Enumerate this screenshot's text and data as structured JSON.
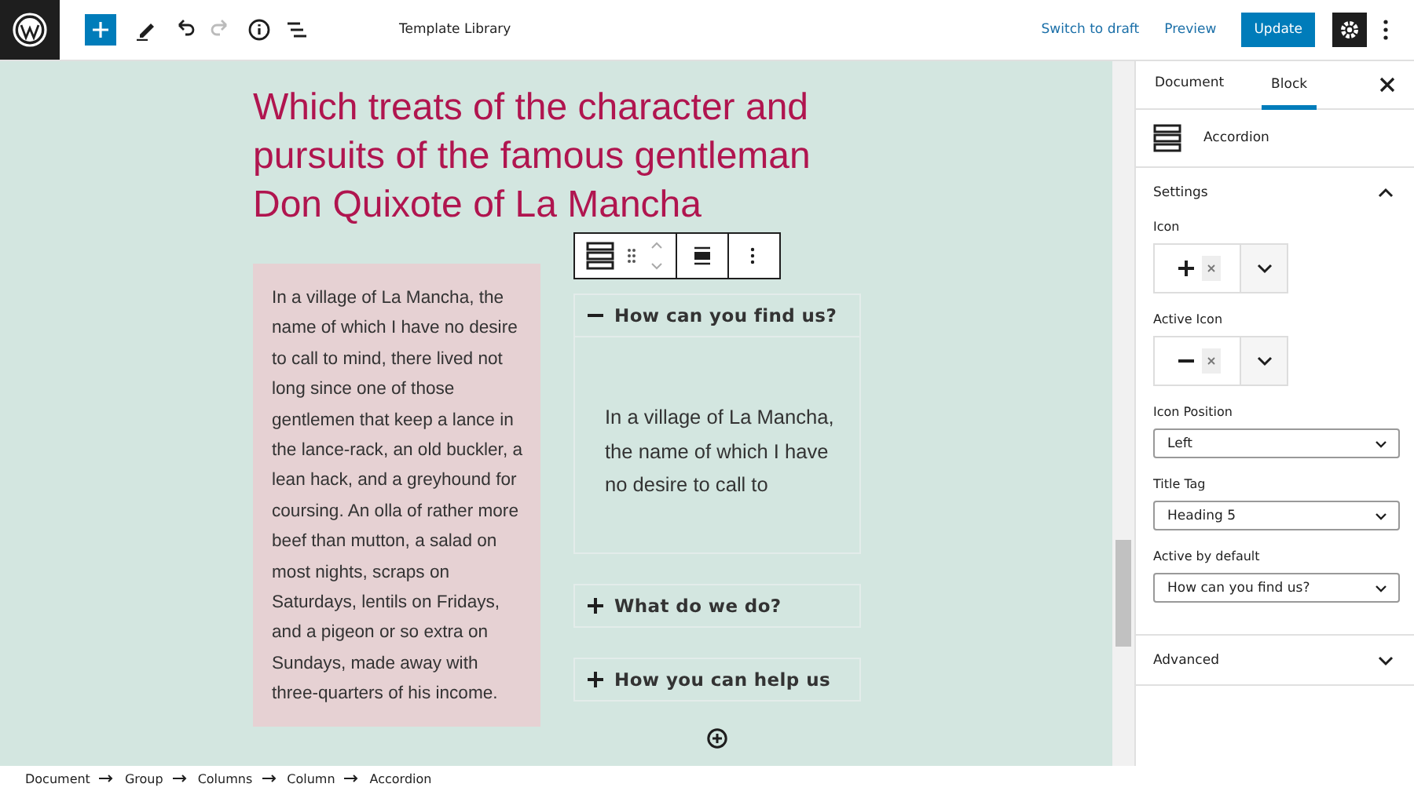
{
  "topbar": {
    "title": "Template Library",
    "actions": [
      {
        "label": "Switch to draft",
        "kind": "link"
      },
      {
        "label": "Preview",
        "kind": "link"
      },
      {
        "label": "Update",
        "kind": "primary"
      }
    ]
  },
  "content": {
    "heading": "Which treats of the character and pursuits of the famous gentleman Don Quixote of La Mancha",
    "paragraph": "In a village of La Mancha, the name of which I have no desire to call to mind, there lived not long since one of those gentlemen that keep a lance in the lance-rack, an old buckler, a lean hack, and a greyhound for coursing. An olla of rather more beef than mutton, a salad on most nights, scraps on Saturdays, lentils on Fridays, and a pigeon or so extra on Sundays, made away with three-quarters of his income.",
    "accordion": [
      {
        "title": "How can you find us?",
        "expanded": true,
        "body": "In a village of La Mancha, the name of which I have no desire to call to"
      },
      {
        "title": "What do we do?",
        "expanded": false
      },
      {
        "title": "How you can help us",
        "expanded": false
      }
    ]
  },
  "sidebar": {
    "tabs": [
      {
        "label": "Document",
        "selected": false
      },
      {
        "label": "Block",
        "selected": true
      }
    ],
    "block_name": "Accordion",
    "panels": [
      {
        "title": "Settings",
        "expanded": true,
        "fields": [
          {
            "kind": "icon",
            "label": "Icon"
          },
          {
            "kind": "icon",
            "label": "Active Icon"
          },
          {
            "kind": "select",
            "label": "Icon Position",
            "value": "Left"
          },
          {
            "kind": "select",
            "label": "Title Tag",
            "value": "Heading 5"
          },
          {
            "kind": "select",
            "label": "Active by default",
            "value": "How can you find us?"
          }
        ]
      },
      {
        "title": "Advanced",
        "expanded": false
      }
    ]
  },
  "breadcrumb": [
    "Document",
    "Group",
    "Columns",
    "Column",
    "Accordion"
  ]
}
